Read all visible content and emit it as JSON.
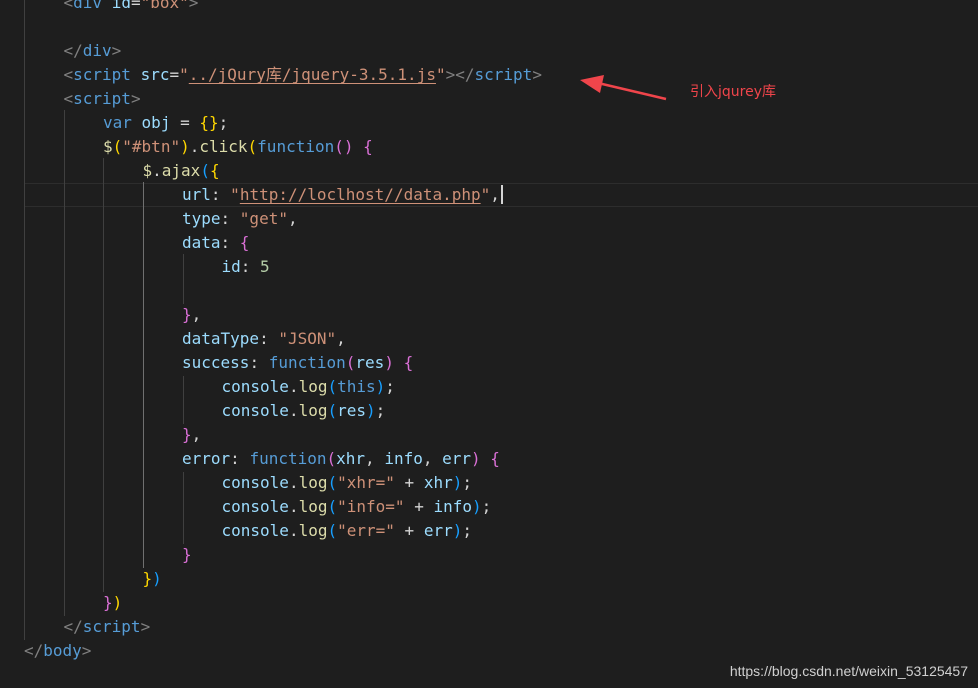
{
  "colors": {
    "background": "#1e1e1e",
    "tag": "#569cd6",
    "bracket_gray": "#808080",
    "attr": "#9cdcfe",
    "string": "#ce9178",
    "keyword": "#569cd6",
    "function": "#dcdcaa",
    "number": "#b5cea8",
    "brace_gold": "#ffd700",
    "brace_purple": "#da70d6",
    "brace_blue": "#179fff",
    "text": "#d4d4d4",
    "annotation": "#f0454b"
  },
  "code_lines": [
    {
      "indent": 1,
      "tokens": [
        [
          "<",
          "bracket_gray"
        ],
        [
          "div",
          "tag"
        ],
        [
          " ",
          "text"
        ],
        [
          "id",
          "attr"
        ],
        [
          "=",
          "text"
        ],
        [
          "\"box\"",
          "string"
        ],
        [
          ">",
          "bracket_gray"
        ]
      ]
    },
    {
      "indent": 0,
      "tokens": []
    },
    {
      "indent": 1,
      "tokens": [
        [
          "</",
          "bracket_gray"
        ],
        [
          "div",
          "tag"
        ],
        [
          ">",
          "bracket_gray"
        ]
      ]
    },
    {
      "indent": 1,
      "tokens": [
        [
          "<",
          "bracket_gray"
        ],
        [
          "script",
          "tag"
        ],
        [
          " ",
          "text"
        ],
        [
          "src",
          "attr"
        ],
        [
          "=",
          "text"
        ],
        [
          "\"",
          "string"
        ],
        [
          "../jQury库/jquery-3.5.1.js",
          "string",
          "u"
        ],
        [
          "\"",
          "string"
        ],
        [
          "></",
          "bracket_gray"
        ],
        [
          "script",
          "tag"
        ],
        [
          ">",
          "bracket_gray"
        ]
      ]
    },
    {
      "indent": 1,
      "tokens": [
        [
          "<",
          "bracket_gray"
        ],
        [
          "script",
          "tag"
        ],
        [
          ">",
          "bracket_gray"
        ]
      ]
    },
    {
      "indent": 2,
      "tokens": [
        [
          "var",
          "keyword"
        ],
        [
          " ",
          "text"
        ],
        [
          "obj",
          "attr"
        ],
        [
          " = ",
          "text"
        ],
        [
          "{}",
          "brace_gold"
        ],
        [
          ";",
          "text"
        ]
      ]
    },
    {
      "indent": 2,
      "tokens": [
        [
          "$",
          "function"
        ],
        [
          "(",
          "brace_gold"
        ],
        [
          "\"#btn\"",
          "string"
        ],
        [
          ")",
          "brace_gold"
        ],
        [
          ".",
          "text"
        ],
        [
          "click",
          "function"
        ],
        [
          "(",
          "brace_gold"
        ],
        [
          "function",
          "keyword"
        ],
        [
          "()",
          "brace_purple"
        ],
        [
          " ",
          "text"
        ],
        [
          "{",
          "brace_purple"
        ]
      ]
    },
    {
      "indent": 3,
      "tokens": [
        [
          "$",
          "function"
        ],
        [
          ".",
          "text"
        ],
        [
          "ajax",
          "function"
        ],
        [
          "(",
          "brace_blue"
        ],
        [
          "{",
          "brace_gold"
        ]
      ]
    },
    {
      "indent": 4,
      "tokens": [
        [
          "url",
          "attr"
        ],
        [
          ": ",
          "text"
        ],
        [
          "\"",
          "string"
        ],
        [
          "http://loclhost//data.php",
          "string",
          "u"
        ],
        [
          "\"",
          "string"
        ],
        [
          ",",
          "text"
        ]
      ],
      "caret": true
    },
    {
      "indent": 4,
      "tokens": [
        [
          "type",
          "attr"
        ],
        [
          ": ",
          "text"
        ],
        [
          "\"get\"",
          "string"
        ],
        [
          ",",
          "text"
        ]
      ]
    },
    {
      "indent": 4,
      "tokens": [
        [
          "data",
          "attr"
        ],
        [
          ": ",
          "text"
        ],
        [
          "{",
          "brace_purple"
        ]
      ]
    },
    {
      "indent": 5,
      "tokens": [
        [
          "id",
          "attr"
        ],
        [
          ": ",
          "text"
        ],
        [
          "5",
          "number"
        ]
      ]
    },
    {
      "indent": 0,
      "tokens": []
    },
    {
      "indent": 4,
      "tokens": [
        [
          "}",
          "brace_purple"
        ],
        [
          ",",
          "text"
        ]
      ]
    },
    {
      "indent": 4,
      "tokens": [
        [
          "dataType",
          "attr"
        ],
        [
          ": ",
          "text"
        ],
        [
          "\"JSON\"",
          "string"
        ],
        [
          ",",
          "text"
        ]
      ]
    },
    {
      "indent": 4,
      "tokens": [
        [
          "success",
          "attr"
        ],
        [
          ": ",
          "text"
        ],
        [
          "function",
          "keyword"
        ],
        [
          "(",
          "brace_purple"
        ],
        [
          "res",
          "attr"
        ],
        [
          ")",
          "brace_purple"
        ],
        [
          " ",
          "text"
        ],
        [
          "{",
          "brace_purple"
        ]
      ]
    },
    {
      "indent": 5,
      "tokens": [
        [
          "console",
          "attr"
        ],
        [
          ".",
          "text"
        ],
        [
          "log",
          "function"
        ],
        [
          "(",
          "brace_blue"
        ],
        [
          "this",
          "keyword"
        ],
        [
          ")",
          "brace_blue"
        ],
        [
          ";",
          "text"
        ]
      ]
    },
    {
      "indent": 5,
      "tokens": [
        [
          "console",
          "attr"
        ],
        [
          ".",
          "text"
        ],
        [
          "log",
          "function"
        ],
        [
          "(",
          "brace_blue"
        ],
        [
          "res",
          "attr"
        ],
        [
          ")",
          "brace_blue"
        ],
        [
          ";",
          "text"
        ]
      ]
    },
    {
      "indent": 4,
      "tokens": [
        [
          "}",
          "brace_purple"
        ],
        [
          ",",
          "text"
        ]
      ]
    },
    {
      "indent": 4,
      "tokens": [
        [
          "error",
          "attr"
        ],
        [
          ": ",
          "text"
        ],
        [
          "function",
          "keyword"
        ],
        [
          "(",
          "brace_purple"
        ],
        [
          "xhr",
          "attr"
        ],
        [
          ", ",
          "text"
        ],
        [
          "info",
          "attr"
        ],
        [
          ", ",
          "text"
        ],
        [
          "err",
          "attr"
        ],
        [
          ")",
          "brace_purple"
        ],
        [
          " ",
          "text"
        ],
        [
          "{",
          "brace_purple"
        ]
      ]
    },
    {
      "indent": 5,
      "tokens": [
        [
          "console",
          "attr"
        ],
        [
          ".",
          "text"
        ],
        [
          "log",
          "function"
        ],
        [
          "(",
          "brace_blue"
        ],
        [
          "\"xhr=\"",
          "string"
        ],
        [
          " + ",
          "text"
        ],
        [
          "xhr",
          "attr"
        ],
        [
          ")",
          "brace_blue"
        ],
        [
          ";",
          "text"
        ]
      ]
    },
    {
      "indent": 5,
      "tokens": [
        [
          "console",
          "attr"
        ],
        [
          ".",
          "text"
        ],
        [
          "log",
          "function"
        ],
        [
          "(",
          "brace_blue"
        ],
        [
          "\"info=\"",
          "string"
        ],
        [
          " + ",
          "text"
        ],
        [
          "info",
          "attr"
        ],
        [
          ")",
          "brace_blue"
        ],
        [
          ";",
          "text"
        ]
      ]
    },
    {
      "indent": 5,
      "tokens": [
        [
          "console",
          "attr"
        ],
        [
          ".",
          "text"
        ],
        [
          "log",
          "function"
        ],
        [
          "(",
          "brace_blue"
        ],
        [
          "\"err=\"",
          "string"
        ],
        [
          " + ",
          "text"
        ],
        [
          "err",
          "attr"
        ],
        [
          ")",
          "brace_blue"
        ],
        [
          ";",
          "text"
        ]
      ]
    },
    {
      "indent": 4,
      "tokens": [
        [
          "}",
          "brace_purple"
        ]
      ]
    },
    {
      "indent": 3,
      "tokens": [
        [
          "}",
          "brace_gold"
        ],
        [
          ")",
          "brace_blue"
        ]
      ]
    },
    {
      "indent": 2,
      "tokens": [
        [
          "}",
          "brace_purple"
        ],
        [
          ")",
          "brace_gold"
        ]
      ]
    },
    {
      "indent": 1,
      "tokens": [
        [
          "</",
          "bracket_gray"
        ],
        [
          "script",
          "tag"
        ],
        [
          ">",
          "bracket_gray"
        ]
      ]
    },
    {
      "indent": 0,
      "tokens": [
        [
          "</",
          "bracket_gray"
        ],
        [
          "body",
          "tag"
        ],
        [
          ">",
          "bracket_gray"
        ]
      ]
    }
  ],
  "annotation": {
    "text": "引入jqurey库"
  },
  "watermark": {
    "text": "https://blog.csdn.net/weixin_53125457"
  }
}
